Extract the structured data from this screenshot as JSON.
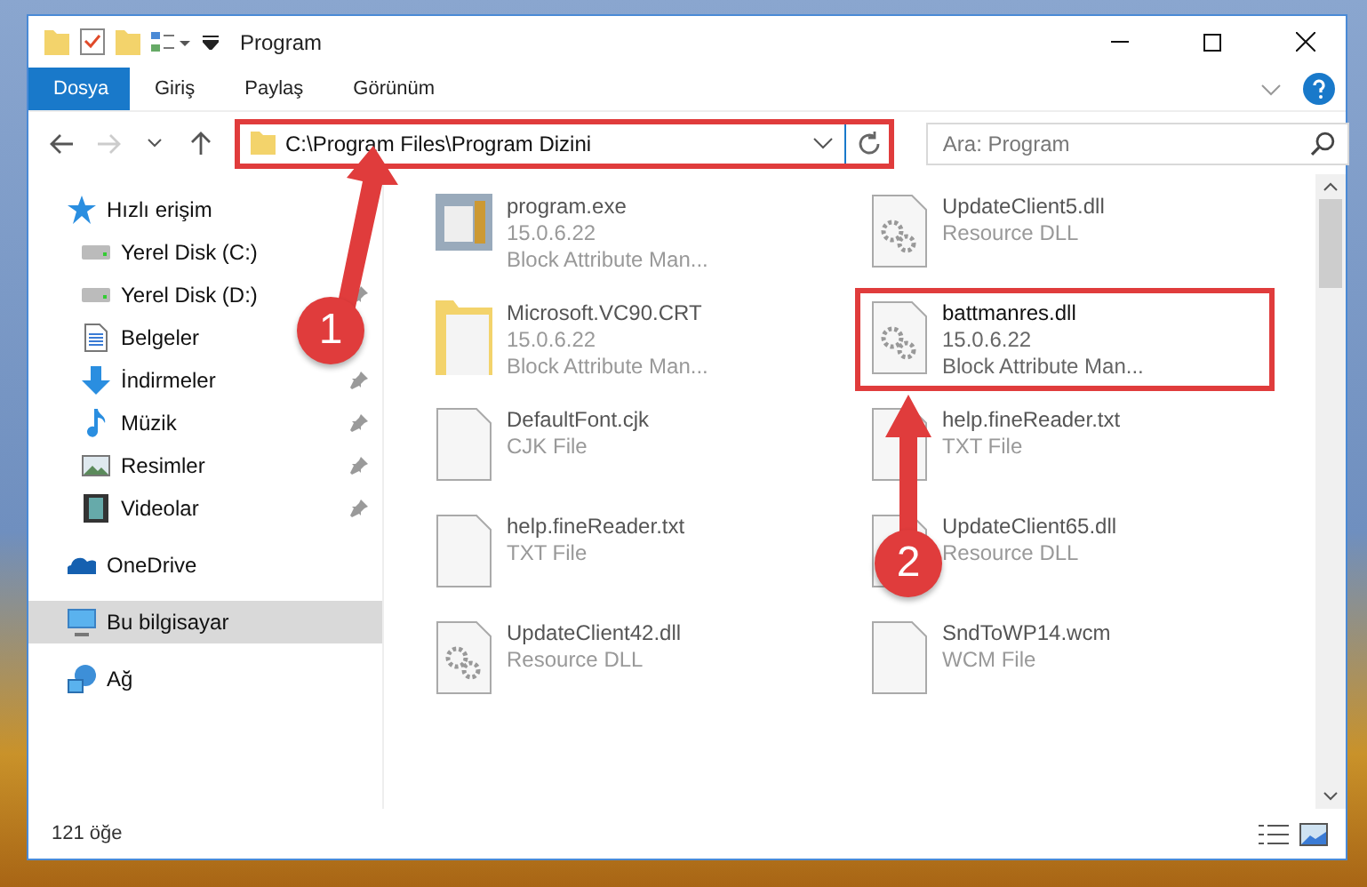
{
  "window": {
    "title": "Program"
  },
  "ribbon_tabs": [
    {
      "label": "Dosya",
      "selected": true
    },
    {
      "label": "Giriş",
      "selected": false
    },
    {
      "label": "Paylaş",
      "selected": false
    },
    {
      "label": "Görünüm",
      "selected": false
    }
  ],
  "address_bar": {
    "path": "C:\\Program Files\\Program Dizini",
    "highlighted": true
  },
  "search": {
    "placeholder": "Ara: Program"
  },
  "sidebar": {
    "items": [
      {
        "label": "Hızlı erişim",
        "kind": "star",
        "selected": false,
        "children": [
          {
            "label": "Yerel Disk (C:)",
            "kind": "drive",
            "selected": false,
            "pinned": false
          },
          {
            "label": "Yerel Disk (D:)",
            "kind": "drive",
            "selected": false,
            "pinned": true
          },
          {
            "label": "Belgeler",
            "kind": "documents",
            "selected": false,
            "pinned": false
          },
          {
            "label": "İndirmeler",
            "kind": "download",
            "selected": false,
            "pinned": true
          },
          {
            "label": "Müzik",
            "kind": "music",
            "selected": false,
            "pinned": true
          },
          {
            "label": "Resimler",
            "kind": "pictures",
            "selected": false,
            "pinned": true
          },
          {
            "label": "Videolar",
            "kind": "videos",
            "selected": false,
            "pinned": true
          }
        ]
      },
      {
        "label": "OneDrive",
        "kind": "cloud",
        "selected": false
      },
      {
        "label": "Bu bilgisayar",
        "kind": "computer",
        "selected": true
      },
      {
        "label": "Ağ",
        "kind": "network",
        "selected": false
      }
    ]
  },
  "files": [
    {
      "name": "program.exe",
      "details": [
        "15.0.6.22",
        "Block Attribute Man..."
      ],
      "kind": "exe",
      "highlighted": false
    },
    {
      "name": "UpdateClient5.dll",
      "details": [
        "Resource DLL"
      ],
      "kind": "dll",
      "highlighted": false
    },
    {
      "name": "Microsoft.VC90.CRT",
      "details": [
        "15.0.6.22",
        "Block Attribute Man..."
      ],
      "kind": "folder",
      "highlighted": false
    },
    {
      "name": "battmanres.dll",
      "details": [
        "15.0.6.22",
        "Block Attribute Man..."
      ],
      "kind": "dll",
      "highlighted": true
    },
    {
      "name": "DefaultFont.cjk",
      "details": [
        "CJK File"
      ],
      "kind": "file",
      "highlighted": false
    },
    {
      "name": "help.fineReader.txt",
      "details": [
        "TXT File"
      ],
      "kind": "file",
      "highlighted": false
    },
    {
      "name": "help.fineReader.txt",
      "details": [
        "TXT File"
      ],
      "kind": "file",
      "highlighted": false
    },
    {
      "name": "UpdateClient65.dll",
      "details": [
        "Resource DLL"
      ],
      "kind": "dll",
      "highlighted": false
    },
    {
      "name": "UpdateClient42.dll",
      "details": [
        "Resource DLL"
      ],
      "kind": "dll",
      "highlighted": false
    },
    {
      "name": "SndToWP14.wcm",
      "details": [
        "WCM File"
      ],
      "kind": "file",
      "highlighted": false
    }
  ],
  "status_bar": {
    "item_count": "121 öğe"
  },
  "callouts": [
    {
      "number": "1"
    },
    {
      "number": "2"
    }
  ]
}
